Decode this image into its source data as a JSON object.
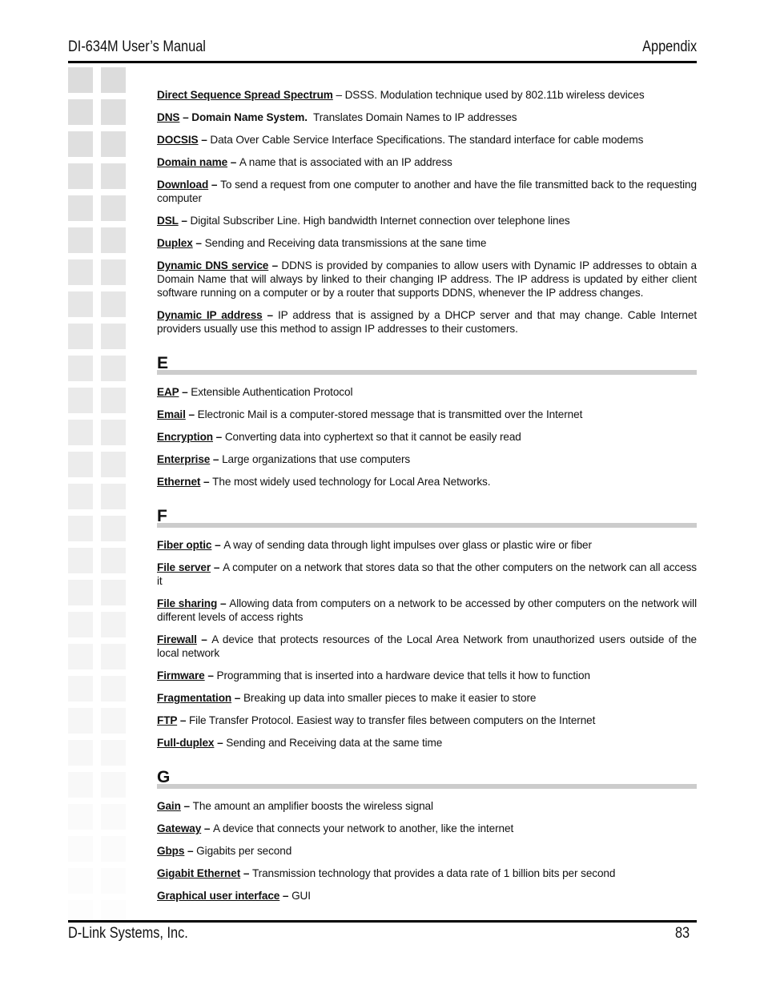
{
  "header": {
    "title": "DI-634M User’s Manual",
    "section": "Appendix"
  },
  "footer": {
    "company": "D-Link Systems, Inc.",
    "page_number": "83"
  },
  "groups": [
    {
      "letter": null,
      "entries": [
        {
          "term": "Direct Sequence Spread Spectrum",
          "sep": " – ",
          "def": "DSSS. Modulation technique used by 802.11b wireless devices",
          "bold_sep": false
        },
        {
          "term": "DNS",
          "sep": " – ",
          "def": "Domain Name System.",
          "def_bold": true,
          "def_rest": "  Translates Domain Names to IP addresses",
          "bold_sep": true
        },
        {
          "term": "DOCSIS",
          "sep": " – ",
          "def": "Data Over Cable Service Interface Specifications.  The standard interface for cable modems",
          "bold_sep": true
        },
        {
          "term": "Domain name",
          "sep": " – ",
          "def": "A name that is associated with an IP address",
          "bold_sep": true
        },
        {
          "term": "Download",
          "sep": " – ",
          "def": "To send a request from one computer to another and have the file transmitted back to the requesting computer",
          "bold_sep": true
        },
        {
          "term": "DSL",
          "sep": " – ",
          "def": "Digital Subscriber Line.  High bandwidth Internet connection over telephone lines",
          "bold_sep": true
        },
        {
          "term": "Duplex",
          "sep": " – ",
          "def": "Sending and Receiving data transmissions at the sane time",
          "bold_sep": true
        },
        {
          "term": "Dynamic DNS service",
          "sep": " – ",
          "def": "DDNS is provided by companies to allow users with Dynamic IP addresses to obtain a Domain Name that will always by linked to their changing IP address.  The IP address is updated by either client software running on a computer or by a router that supports DDNS, whenever the IP address changes.",
          "bold_sep": true
        },
        {
          "term": "Dynamic IP address",
          "sep": " – ",
          "def": "IP address that is assigned by a DHCP server and that may change.  Cable Internet providers usually use this method to assign IP addresses to their customers.",
          "bold_sep": true
        }
      ]
    },
    {
      "letter": "E",
      "entries": [
        {
          "term": "EAP",
          "sep": " – ",
          "def": "Extensible Authentication Protocol",
          "bold_sep": true
        },
        {
          "term": "Email",
          "sep": " – ",
          "def": "Electronic Mail is a computer-stored message that is transmitted over the Internet",
          "bold_sep": true
        },
        {
          "term": "Encryption",
          "sep": " – ",
          "def": "Converting data into cyphertext so that it cannot be easily read",
          "bold_sep": true
        },
        {
          "term": "Enterprise",
          "sep": " – ",
          "def": "Large organizations that use computers",
          "bold_sep": true
        },
        {
          "term": "Ethernet",
          "sep": " – ",
          "def": "The most widely used technology for Local Area Networks.",
          "bold_sep": true
        }
      ]
    },
    {
      "letter": "F",
      "entries": [
        {
          "term": "Fiber optic",
          "sep": " – ",
          "def": "A way of sending data through light impulses over glass or plastic wire or fiber",
          "bold_sep": true
        },
        {
          "term": "File server",
          "sep": " – ",
          "def": "A computer on a network that stores data so that the other computers on the network can all access it",
          "bold_sep": true
        },
        {
          "term": "File sharing",
          "sep": " – ",
          "def": "Allowing data from computers on a network to be accessed by other computers on the network will different levels of access rights",
          "bold_sep": true
        },
        {
          "term": "Firewall",
          "sep": " – ",
          "def": "A device that protects resources of the Local Area Network from unauthorized users outside of the local network",
          "bold_sep": true
        },
        {
          "term": "Firmware",
          "sep": " – ",
          "def": "Programming that is inserted into a hardware device that tells it how to function",
          "bold_sep": true
        },
        {
          "term": "Fragmentation",
          "sep": " – ",
          "def": "Breaking up data into smaller pieces to make it easier to store",
          "bold_sep": true
        },
        {
          "term": "FTP",
          "sep": " – ",
          "def": "File Transfer Protocol.  Easiest way to transfer files between computers on the Internet",
          "bold_sep": true
        },
        {
          "term": "Full-duplex",
          "sep": " – ",
          "def": "Sending and Receiving data at the same time",
          "bold_sep": true
        }
      ]
    },
    {
      "letter": "G",
      "entries": [
        {
          "term": "Gain",
          "sep": " – ",
          "def": "The amount an amplifier boosts the wireless signal",
          "bold_sep": true
        },
        {
          "term": "Gateway",
          "sep": " – ",
          "def": "A device that connects your network to another, like the internet",
          "bold_sep": true
        },
        {
          "term": "Gbps",
          "sep": " – ",
          "def": "Gigabits per second",
          "bold_sep": true
        },
        {
          "term": "Gigabit Ethernet",
          "sep": " – ",
          "def": "Transmission technology that provides a data rate of 1 billion bits per second",
          "bold_sep": true
        },
        {
          "term": "Graphical user interface",
          "sep": " – ",
          "def": "GUI",
          "bold_sep": true
        }
      ]
    }
  ]
}
